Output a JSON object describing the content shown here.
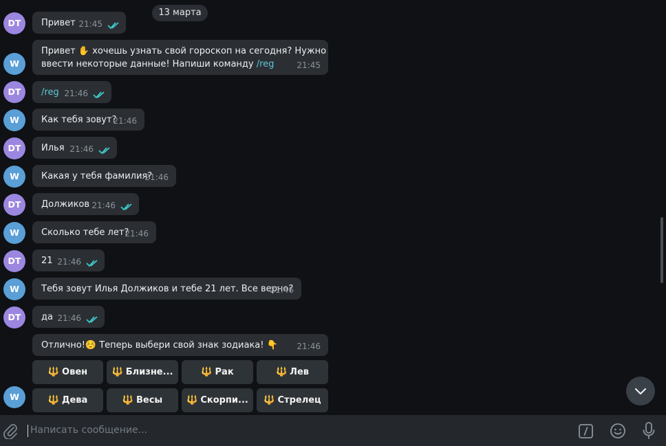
{
  "date_divider": "13 марта",
  "avatars": {
    "user": "DT",
    "bot": "W"
  },
  "messages": [
    {
      "text": "Привет",
      "time": "21:45"
    },
    {
      "text_line1": "Привет ✋ хочешь узнать свой гороскоп на сегодня? Нужно",
      "text_line2": "ввести некоторые данные! Напиши команду ",
      "command": "/reg",
      "time": "21:45"
    },
    {
      "text": "/reg",
      "time": "21:46"
    },
    {
      "text": "Как тебя зовут?",
      "time": "21:46"
    },
    {
      "text": "Илья",
      "time": "21:46"
    },
    {
      "text": "Какая у тебя фамилия?",
      "time": "21:46"
    },
    {
      "text": "Должиков",
      "time": "21:46"
    },
    {
      "text": "Сколько тебе лет?",
      "time": "21:46"
    },
    {
      "text": "21",
      "time": "21:46"
    },
    {
      "text": "Тебя зовут Илья Должиков и тебе 21 лет. Все верно?",
      "time": "21:46"
    },
    {
      "text": "да",
      "time": "21:46"
    },
    {
      "text": "Отлично!☺️ Теперь выбери свой знак зодиака! 👇",
      "time": "21:46"
    }
  ],
  "keyboard": {
    "icon": "trident-icon",
    "glyph": "🔱",
    "buttons": [
      "Овен",
      "Близне...",
      "Рак",
      "Лев",
      "Дева",
      "Весы",
      "Скорпи...",
      "Стрелец"
    ]
  },
  "composer": {
    "placeholder": "Написать сообщение..."
  },
  "colors": {
    "chat_bg": "#0f1114",
    "bubble": "#2b2f33",
    "accent": "#5dc8d8",
    "check": "#3fc8c9"
  }
}
